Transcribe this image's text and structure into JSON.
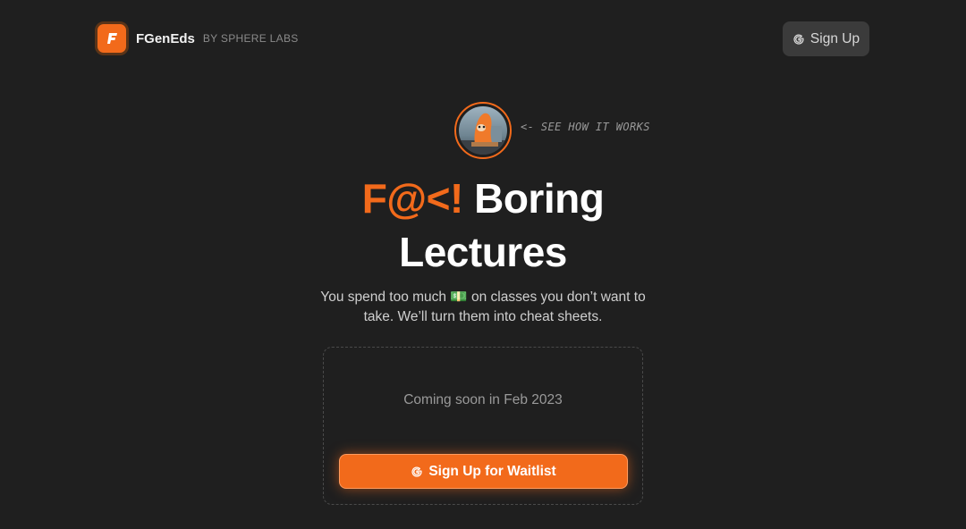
{
  "brand": {
    "name": "FGenEds",
    "byline": "BY SPHERE LABS",
    "logo_letter": "F"
  },
  "header": {
    "signup_label": "Sign Up",
    "signup_icon": "google-icon"
  },
  "hero": {
    "how_it_works": "<- See how it works",
    "headline_accent": "F@<!",
    "headline_rest_1": "Boring",
    "headline_rest_2": "Lectures",
    "subtitle_part1": "You spend too much",
    "subtitle_emoji": "💵",
    "subtitle_part2": "on classes you don’t want to take. We’ll turn them into cheat sheets."
  },
  "card": {
    "coming_soon": "Coming soon in Feb 2023",
    "waitlist_label": "Sign Up for Waitlist",
    "waitlist_icon": "google-icon"
  },
  "colors": {
    "accent": "#f26a1b",
    "background": "#1f1f1f",
    "button_dark": "#3b3b3b"
  }
}
